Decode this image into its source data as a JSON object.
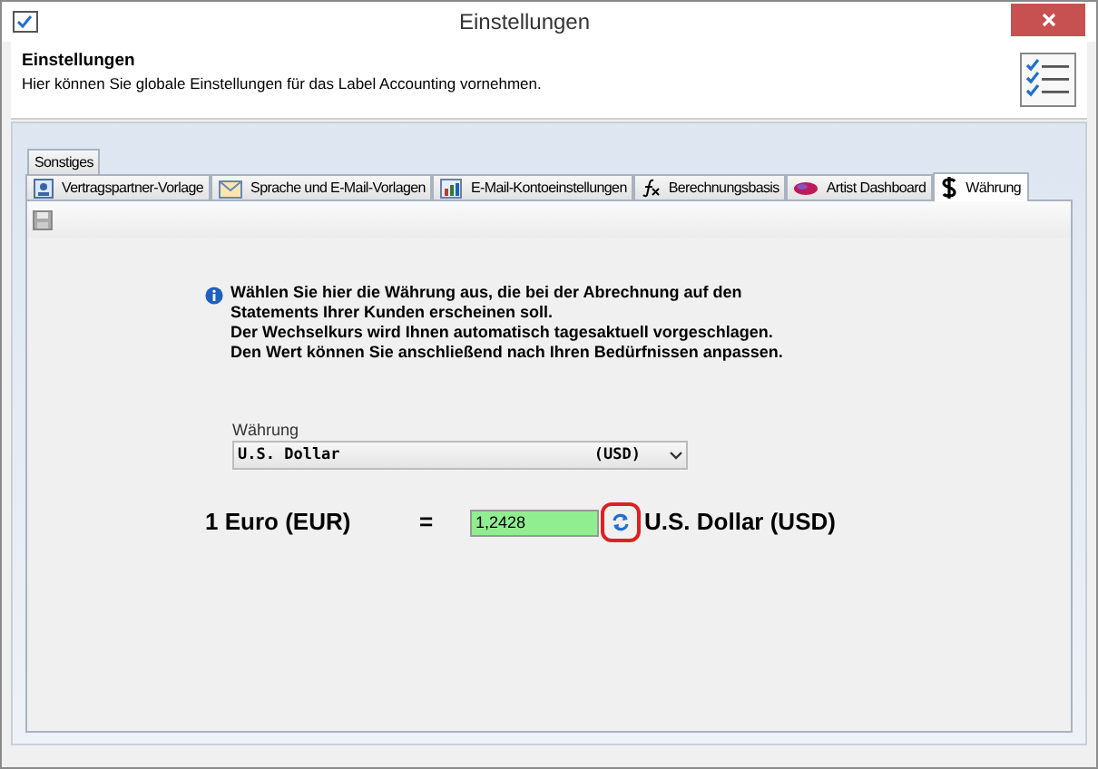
{
  "window": {
    "title": "Einstellungen"
  },
  "header": {
    "title": "Einstellungen",
    "description": "Hier können Sie globale Einstellungen für das Label Accounting vornehmen."
  },
  "tab_rows": [
    [
      {
        "label": "Sonstiges",
        "kind": "none",
        "selected": false
      }
    ],
    [
      {
        "label": "Vertragspartner-Vorlage",
        "kind": "contact",
        "selected": false
      },
      {
        "label": "Sprache und E-Mail-Vorlagen",
        "kind": "mail",
        "selected": false
      },
      {
        "label": "E-Mail-Kontoeinstellungen",
        "kind": "settings",
        "selected": false
      },
      {
        "label": "Berechnungsbasis",
        "kind": "formula",
        "selected": false
      },
      {
        "label": "Artist Dashboard",
        "kind": "dashboard",
        "selected": false
      },
      {
        "label": "Währung",
        "kind": "dollar",
        "selected": true
      }
    ]
  ],
  "info": [
    "Wählen Sie hier die Währung aus, die bei der Abrechnung auf den",
    "Statements Ihrer Kunden erscheinen soll.",
    "Der Wechselkurs wird Ihnen automatisch tagesaktuell vorgeschlagen.",
    "Den Wert können Sie anschließend nach Ihren Bedürfnissen anpassen."
  ],
  "currency": {
    "label": "Währung",
    "name": "U.S. Dollar",
    "code": "(USD)"
  },
  "rate": {
    "left": "1 Euro (EUR)",
    "equals": "=",
    "value": "1,2428",
    "right": "U.S. Dollar (USD)",
    "highlighted": true
  }
}
